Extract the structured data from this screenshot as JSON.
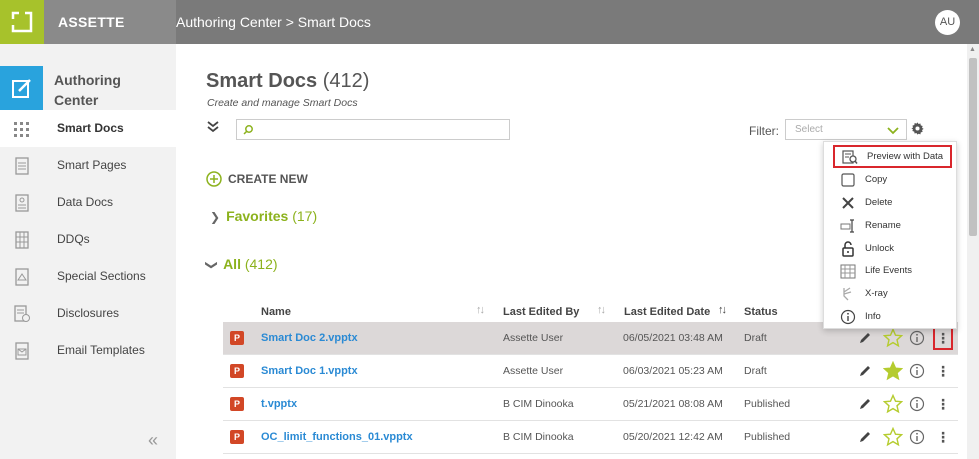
{
  "header": {
    "brand": "ASSETTE",
    "breadcrumb": "Authoring Center > Smart Docs",
    "avatar": "AU"
  },
  "sidebar": {
    "title": "Authoring Center",
    "items": [
      {
        "label": "Smart Docs",
        "icon": "grid-dots-icon",
        "active": true
      },
      {
        "label": "Smart Pages",
        "icon": "page-icon",
        "active": false
      },
      {
        "label": "Data Docs",
        "icon": "data-doc-icon",
        "active": false
      },
      {
        "label": "DDQs",
        "icon": "ddq-icon",
        "active": false
      },
      {
        "label": "Special Sections",
        "icon": "special-section-icon",
        "active": false
      },
      {
        "label": "Disclosures",
        "icon": "disclosure-icon",
        "active": false
      },
      {
        "label": "Email Templates",
        "icon": "email-template-icon",
        "active": false
      }
    ],
    "collapse_glyph": "«"
  },
  "main": {
    "title": "Smart Docs",
    "title_count": "(412)",
    "subtitle": "Create and manage Smart Docs",
    "search_placeholder": "",
    "filter_label": "Filter:",
    "filter_placeholder": "Select",
    "create_new": "CREATE NEW",
    "favorites_label": "Favorites",
    "favorites_count": "(17)",
    "all_label": "All",
    "all_count": "(412)"
  },
  "table": {
    "columns": [
      "Name",
      "Last Edited By",
      "Last Edited Date",
      "Status"
    ],
    "rows": [
      {
        "name": "Smart Doc 2.vpptx",
        "edited_by": "Assette User",
        "date": "06/05/2021 03:48 AM",
        "status": "Draft",
        "favorite": false,
        "selected": true
      },
      {
        "name": "Smart Doc 1.vpptx",
        "edited_by": "Assette User",
        "date": "06/03/2021 05:23 AM",
        "status": "Draft",
        "favorite": true,
        "selected": false
      },
      {
        "name": "t.vpptx",
        "edited_by": "B CIM Dinooka",
        "date": "05/21/2021 08:08 AM",
        "status": "Published",
        "favorite": false,
        "selected": false
      },
      {
        "name": "OC_limit_functions_01.vpptx",
        "edited_by": "B CIM Dinooka",
        "date": "05/20/2021 12:42 AM",
        "status": "Published",
        "favorite": false,
        "selected": false
      }
    ],
    "file_badge": "P"
  },
  "context_menu": {
    "items": [
      {
        "label": "Preview with Data",
        "icon": "preview-data-icon"
      },
      {
        "label": "Copy",
        "icon": "copy-icon"
      },
      {
        "label": "Delete",
        "icon": "delete-x-icon"
      },
      {
        "label": "Rename",
        "icon": "rename-icon"
      },
      {
        "label": "Unlock",
        "icon": "unlock-icon"
      },
      {
        "label": "Life Events",
        "icon": "life-events-icon"
      },
      {
        "label": "X-ray",
        "icon": "xray-icon"
      },
      {
        "label": "Info",
        "icon": "info-icon"
      }
    ]
  },
  "colors": {
    "accent_green": "#8cb21d",
    "logo_green": "#a7c22b",
    "sidebar_blue": "#29a3dd",
    "link_blue": "#2a8ad4",
    "highlight_red": "#d9262c",
    "topbar_gray": "#7a7a7a"
  }
}
